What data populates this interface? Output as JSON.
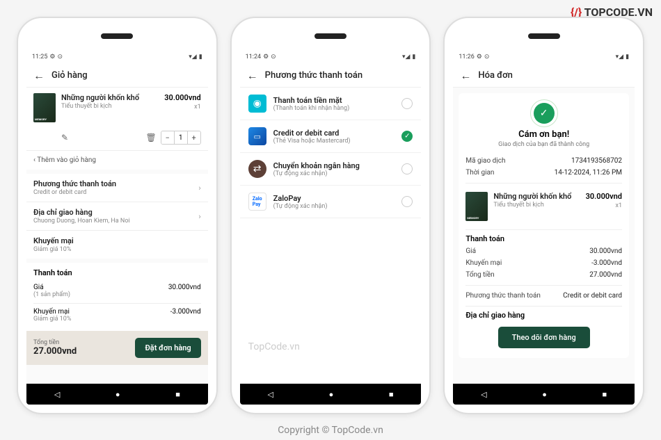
{
  "watermark_logo": "TOPCODE.VN",
  "copyright": "Copyright © TopCode.vn",
  "inline_watermark": "TopCode.vn",
  "screen1": {
    "time": "11:25",
    "title": "Giỏ hàng",
    "item": {
      "title": "Những người khốn khổ",
      "subtitle": "Tiểu thuyết bi kịch",
      "price": "30.000vnd",
      "qty": "x1",
      "qty_value": "1"
    },
    "add_more": "Thêm vào giỏ hàng",
    "payment_method": {
      "label": "Phương thức thanh toán",
      "value": "Credit or debit card"
    },
    "address": {
      "label": "Địa chỉ giao hàng",
      "value": "Chuong Duong, Hoan Kiem, Ha Noi"
    },
    "promo": {
      "label": "Khuyến mại",
      "value": "Giảm giá 10%"
    },
    "payment": {
      "title": "Thanh toán",
      "price_label": "Giá",
      "price_sub": "(1 sản phẩm)",
      "price_value": "30.000vnd",
      "discount_label": "Khuyến mại",
      "discount_sub": "Giảm giá 10%",
      "discount_value": "-3.000vnd"
    },
    "total": {
      "label": "Tổng tiền",
      "amount": "27.000vnd",
      "button": "Đặt đơn hàng"
    }
  },
  "screen2": {
    "time": "11:24",
    "title": "Phương thức thanh toán",
    "options": [
      {
        "name": "Thanh toán tiền mặt",
        "desc": "(Thanh toán khi nhận hàng)"
      },
      {
        "name": "Credit or debit card",
        "desc": "(Thẻ Visa hoặc Mastercard)"
      },
      {
        "name": "Chuyển khoản ngân hàng",
        "desc": "(Tự động xác nhận)"
      },
      {
        "name": "ZaloPay",
        "desc": "(Tự động xác nhận)"
      }
    ]
  },
  "screen3": {
    "time": "11:26",
    "title": "Hóa đơn",
    "thanks": "Cám ơn bạn!",
    "thanks_sub": "Giao dịch của bạn đã thành công",
    "txn_id_label": "Mã giao dịch",
    "txn_id": "1734193568702",
    "time_label": "Thời gian",
    "time_value": "14-12-2024, 11:26 PM",
    "item": {
      "title": "Những người khốn khổ",
      "subtitle": "Tiểu thuyết bi kịch",
      "price": "30.000vnd",
      "qty": "x1"
    },
    "payment_title": "Thanh toán",
    "rows": {
      "price_label": "Giá",
      "price_value": "30.000vnd",
      "discount_label": "Khuyến mại",
      "discount_value": "-3.000vnd",
      "total_label": "Tổng tiền",
      "total_value": "27.000vnd",
      "method_label": "Phương thức thanh toán",
      "method_value": "Credit or debit card"
    },
    "address_label": "Địa chỉ giao hàng",
    "track_button": "Theo dõi đơn hàng"
  }
}
